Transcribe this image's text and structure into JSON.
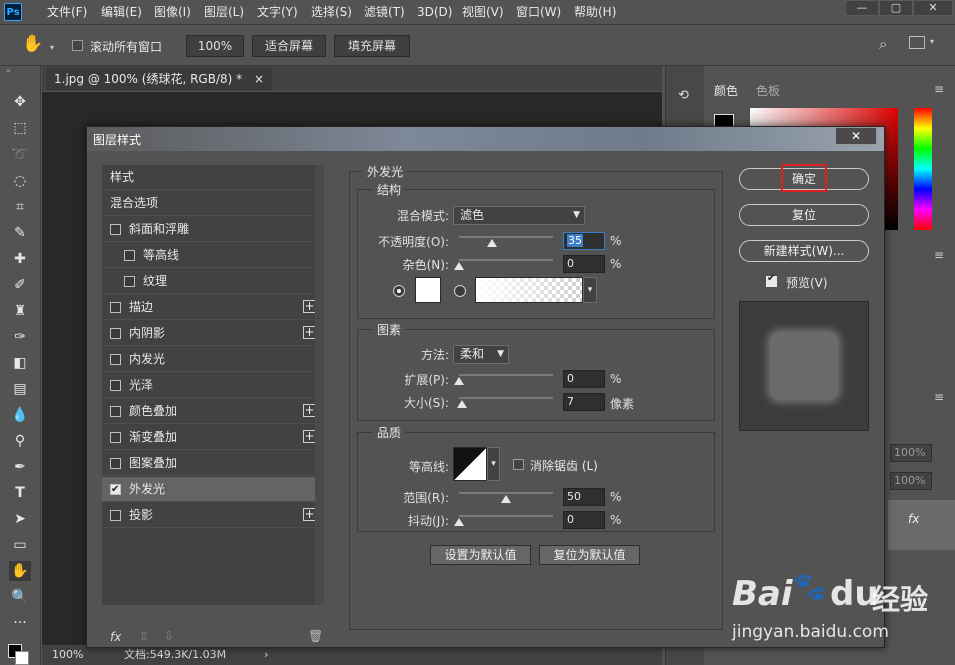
{
  "menubar": {
    "logo": "Ps",
    "items": [
      "文件(F)",
      "编辑(E)",
      "图像(I)",
      "图层(L)",
      "文字(Y)",
      "选择(S)",
      "滤镜(T)",
      "3D(D)",
      "视图(V)",
      "窗口(W)",
      "帮助(H)"
    ]
  },
  "options": {
    "scroll_all_label": "滚动所有窗口",
    "zoom_value": "100%",
    "fit_screen": "适合屏幕",
    "fill_screen": "填充屏幕"
  },
  "document": {
    "tab_title": "1.jpg @ 100% (绣球花, RGB/8) *",
    "tab_close": "×",
    "status_zoom": "100%",
    "status_doc": "文档:549.3K/1.03M"
  },
  "right_panel": {
    "color_tab": "颜色",
    "swatches_tab": "色板",
    "opacity_a": "100%",
    "opacity_b": "100%",
    "fx": "fx"
  },
  "dialog": {
    "title": "图层样式",
    "close": "✕",
    "list": [
      {
        "label": "样式",
        "checkbox": false,
        "plus": false,
        "indent": 0,
        "selected": false
      },
      {
        "label": "混合选项",
        "checkbox": false,
        "plus": false,
        "indent": 0,
        "selected": false
      },
      {
        "label": "斜面和浮雕",
        "checkbox": true,
        "checked": false,
        "plus": false,
        "indent": 0,
        "selected": false
      },
      {
        "label": "等高线",
        "checkbox": true,
        "checked": false,
        "plus": false,
        "indent": 1,
        "selected": false
      },
      {
        "label": "纹理",
        "checkbox": true,
        "checked": false,
        "plus": false,
        "indent": 1,
        "selected": false
      },
      {
        "label": "描边",
        "checkbox": true,
        "checked": false,
        "plus": true,
        "indent": 0,
        "selected": false
      },
      {
        "label": "内阴影",
        "checkbox": true,
        "checked": false,
        "plus": true,
        "indent": 0,
        "selected": false
      },
      {
        "label": "内发光",
        "checkbox": true,
        "checked": false,
        "plus": false,
        "indent": 0,
        "selected": false
      },
      {
        "label": "光泽",
        "checkbox": true,
        "checked": false,
        "plus": false,
        "indent": 0,
        "selected": false
      },
      {
        "label": "颜色叠加",
        "checkbox": true,
        "checked": false,
        "plus": true,
        "indent": 0,
        "selected": false
      },
      {
        "label": "渐变叠加",
        "checkbox": true,
        "checked": false,
        "plus": true,
        "indent": 0,
        "selected": false
      },
      {
        "label": "图案叠加",
        "checkbox": true,
        "checked": false,
        "plus": false,
        "indent": 0,
        "selected": false
      },
      {
        "label": "外发光",
        "checkbox": true,
        "checked": true,
        "plus": false,
        "indent": 0,
        "selected": true
      },
      {
        "label": "投影",
        "checkbox": true,
        "checked": false,
        "plus": true,
        "indent": 0,
        "selected": false
      }
    ],
    "footer_fx": "fx",
    "section_title": "外发光",
    "structure": {
      "title": "结构",
      "blend_mode_label": "混合模式:",
      "blend_mode_value": "滤色",
      "opacity_label": "不透明度(O):",
      "opacity_value": "35",
      "opacity_fraction": 0.35,
      "noise_label": "杂色(N):",
      "noise_value": "0",
      "noise_fraction": 0,
      "percent": "%"
    },
    "elements": {
      "title": "图素",
      "method_label": "方法:",
      "method_value": "柔和",
      "spread_label": "扩展(P):",
      "spread_value": "0",
      "spread_fraction": 0,
      "size_label": "大小(S):",
      "size_value": "7",
      "size_fraction": 0.03,
      "percent": "%",
      "pixels": "像素"
    },
    "quality": {
      "title": "品质",
      "contour_label": "等高线:",
      "antialias_label": "消除锯齿 (L)",
      "range_label": "范围(R):",
      "range_value": "50",
      "range_fraction": 0.5,
      "jitter_label": "抖动(J):",
      "jitter_value": "0",
      "jitter_fraction": 0,
      "percent": "%"
    },
    "set_default": "设置为默认值",
    "reset_default": "复位为默认值",
    "ok": "确定",
    "reset": "复位",
    "new_style": "新建样式(W)...",
    "preview_label": "预览(V)",
    "preview_checked": true
  },
  "watermark": {
    "brand": "Bai",
    "brand_suffix": "du",
    "cn": "经验",
    "url": "jingyan.baidu.com"
  },
  "colors": {
    "highlight": "#e02020",
    "selection": "#3d7ec9"
  }
}
